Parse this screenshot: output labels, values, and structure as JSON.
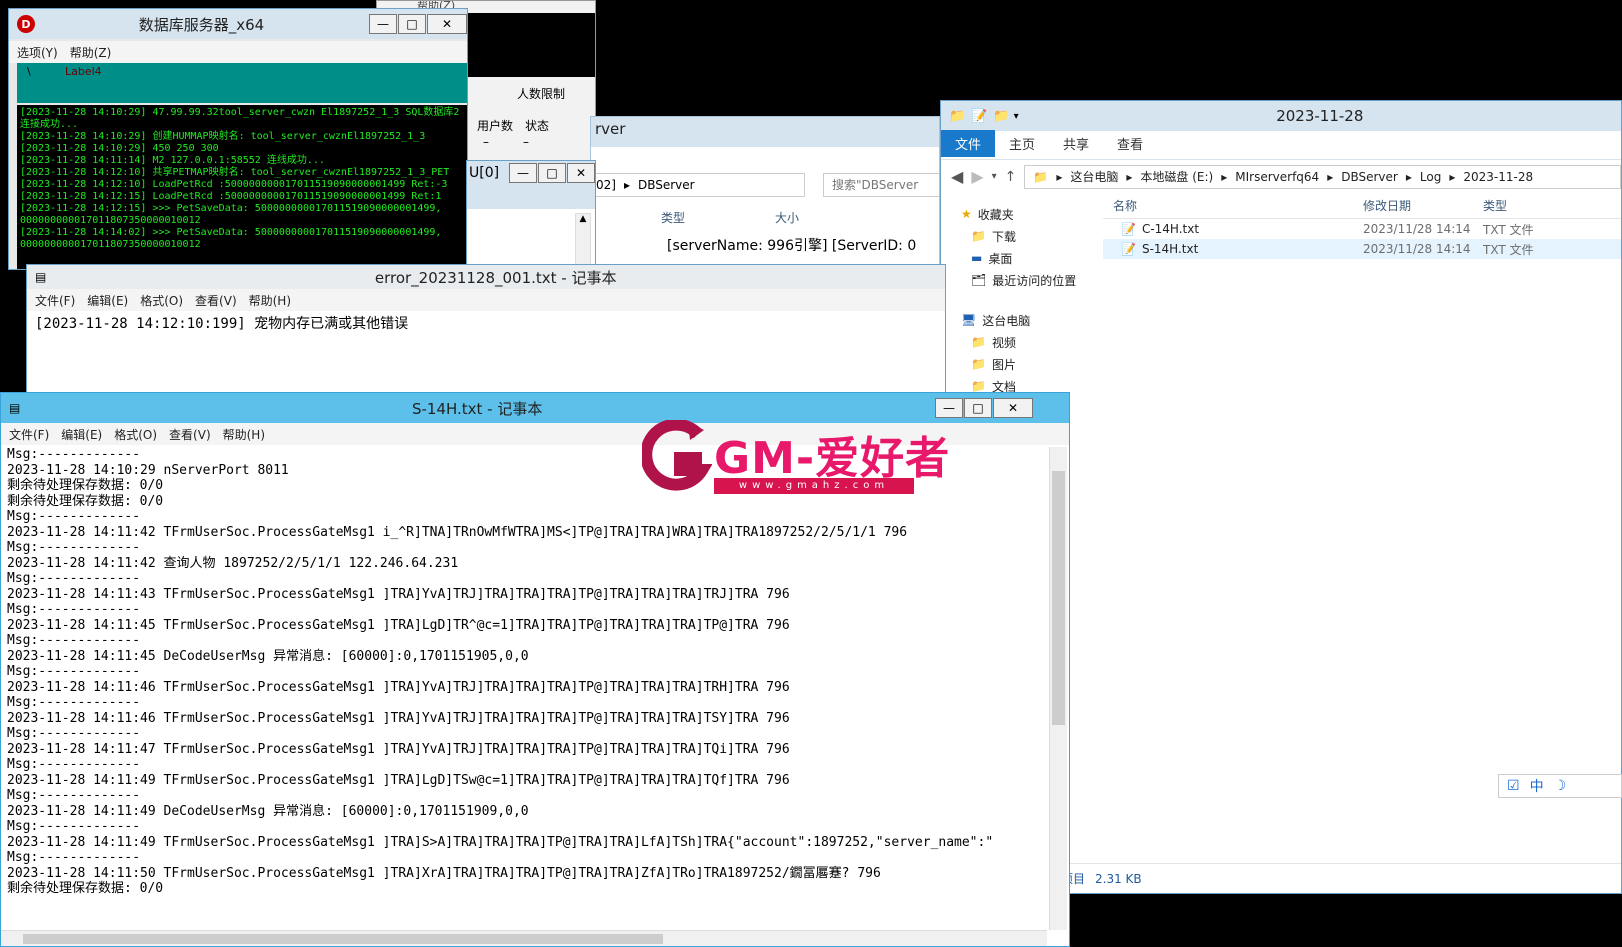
{
  "db_window": {
    "title": "数据库服务器_x64",
    "menu": [
      "选项(Y)",
      "帮助(Z)"
    ],
    "label": "Label4",
    "label_prefix": "\\",
    "log_lines": [
      "[2023-11-28 14:10:29] 47.99.99.32tool_server_cwzn El1897252_1_3 SQL数据库2",
      "连接成功...",
      "[2023-11-28 14:10:29] 创建HUMMAP映射名: tool_server_cwznEl1897252_1_3",
      "[2023-11-28 14:10:29] 450 250 300",
      "[2023-11-28 14:11:14] M2 127.0.0.1:58552 连线成功...",
      "[2023-11-28 14:12:10] 共享PETMAP映射名: tool_server_cwznEl1897252_1_3_PET",
      "[2023-11-28 14:12:10] LoadPetRcd :500000000017011519090000001499 Ret:-3",
      "[2023-11-28 14:12:15] LoadPetRcd :500000000017011519090000001499 Ret:1",
      "[2023-11-28 14:12:15] >>> PetSaveData: 500000000017011519090000001499,",
      "000000000017011807350000010012",
      "[2023-11-28 14:14:02] >>> PetSaveData: 500000000017011519090000001499,",
      "000000000017011807350000010012"
    ]
  },
  "frag_window": {
    "menu_fragment": "帮助(Z)",
    "limit_label": "人数限制",
    "col_users": "用户数",
    "col_status": "状态",
    "dash": "–"
  },
  "mid_window": {
    "title_fragment": "rver",
    "path_fragment": "02]",
    "path_folder": "DBServer",
    "search_placeholder": "搜索\"DBServer",
    "col_type": "类型",
    "col_size": "大小",
    "status_text": "[serverName: 996引擎] [ServerID: 0"
  },
  "u_window": {
    "title": "U[0]"
  },
  "explorer": {
    "title": "2023-11-28",
    "ribbon_tabs": [
      "文件",
      "主页",
      "共享",
      "查看"
    ],
    "breadcrumb": [
      "这台电脑",
      "本地磁盘 (E:)",
      "MIrserverfq64",
      "DBServer",
      "Log",
      "2023-11-28"
    ],
    "nav_items": [
      {
        "label": "收藏夹",
        "icon": "star-icon"
      },
      {
        "label": "下载",
        "icon": "folder-icon"
      },
      {
        "label": "桌面",
        "icon": "desktop-icon"
      },
      {
        "label": "最近访问的位置",
        "icon": "recent-icon"
      },
      {
        "label": "这台电脑",
        "icon": "computer-icon"
      },
      {
        "label": "视频",
        "icon": "folder-icon"
      },
      {
        "label": "图片",
        "icon": "folder-icon"
      },
      {
        "label": "文档",
        "icon": "folder-icon"
      }
    ],
    "columns": [
      "名称",
      "修改日期",
      "类型"
    ],
    "files": [
      {
        "name": "C-14H.txt",
        "date": "2023/11/28 14:14",
        "type": "TXT 文件"
      },
      {
        "name": "S-14H.txt",
        "date": "2023/11/28 14:14",
        "type": "TXT 文件"
      }
    ],
    "status_items": "项目",
    "status_size": "2.31 KB"
  },
  "err_notepad": {
    "title": "error_20231128_001.txt - 记事本",
    "menu": [
      "文件(F)",
      "编辑(E)",
      "格式(O)",
      "查看(V)",
      "帮助(H)"
    ],
    "content": "[2023-11-28 14:12:10:199] 宠物内存已满或其他错误"
  },
  "s_notepad": {
    "title": "S-14H.txt - 记事本",
    "menu": [
      "文件(F)",
      "编辑(E)",
      "格式(O)",
      "查看(V)",
      "帮助(H)"
    ],
    "lines": [
      "Msg:-------------",
      "2023-11-28 14:10:29 nServerPort 8011",
      "剩余待处理保存数据: 0/0",
      "剩余待处理保存数据: 0/0",
      "Msg:-------------",
      "2023-11-28 14:11:42 TFrmUserSoc.ProcessGateMsg1 i_^R]TNA]TRnOwMfWTRA]MS<]TP@]TRA]TRA]WRA]TRA]TRA1897252/2/5/1/1   796",
      "Msg:-------------",
      "2023-11-28 14:11:42 查询人物 1897252/2/5/1/1  122.246.64.231",
      "Msg:-------------",
      "2023-11-28 14:11:43 TFrmUserSoc.ProcessGateMsg1 ]TRA]YvA]TRJ]TRA]TRA]TRA]TP@]TRA]TRA]TRA]TRJ]TRA   796",
      "Msg:-------------",
      "2023-11-28 14:11:45 TFrmUserSoc.ProcessGateMsg1 ]TRA]LgD]TR^@c=1]TRA]TRA]TP@]TRA]TRA]TRA]TP@]TRA   796",
      "Msg:-------------",
      "2023-11-28 14:11:45 DeCodeUserMsg 异常消息:  [60000]:0,1701151905,0,0",
      "Msg:-------------",
      "2023-11-28 14:11:46 TFrmUserSoc.ProcessGateMsg1 ]TRA]YvA]TRJ]TRA]TRA]TRA]TP@]TRA]TRA]TRA]TRH]TRA   796",
      "Msg:-------------",
      "2023-11-28 14:11:46 TFrmUserSoc.ProcessGateMsg1 ]TRA]YvA]TRJ]TRA]TRA]TRA]TP@]TRA]TRA]TRA]TSY]TRA   796",
      "Msg:-------------",
      "2023-11-28 14:11:47 TFrmUserSoc.ProcessGateMsg1 ]TRA]YvA]TRJ]TRA]TRA]TRA]TP@]TRA]TRA]TRA]TQi]TRA   796",
      "Msg:-------------",
      "2023-11-28 14:11:49 TFrmUserSoc.ProcessGateMsg1 ]TRA]LgD]TSw@c=1]TRA]TRA]TP@]TRA]TRA]TRA]TQf]TRA   796",
      "Msg:-------------",
      "2023-11-28 14:11:49 DeCodeUserMsg 异常消息:  [60000]:0,1701151909,0,0",
      "Msg:-------------",
      "2023-11-28 14:11:49 TFrmUserSoc.ProcessGateMsg1 ]TRA]S>A]TRA]TRA]TRA]TP@]TRA]TRA]LfA]TSh]TRA{\"account\":1897252,\"server_name\":\"",
      "Msg:-------------",
      "2023-11-28 14:11:50 TFrmUserSoc.ProcessGateMsg1 ]TRA]XrA]TRA]TRA]TRA]TP@]TRA]TRA]ZfA]TRo]TRA1897252/鐗冨厬蹇?  796",
      "剩余待处理保存数据: 0/0"
    ]
  },
  "watermark": {
    "text": "GM-爱好者",
    "url": "www.gmahz.com"
  },
  "ime": {
    "lang": "中"
  }
}
